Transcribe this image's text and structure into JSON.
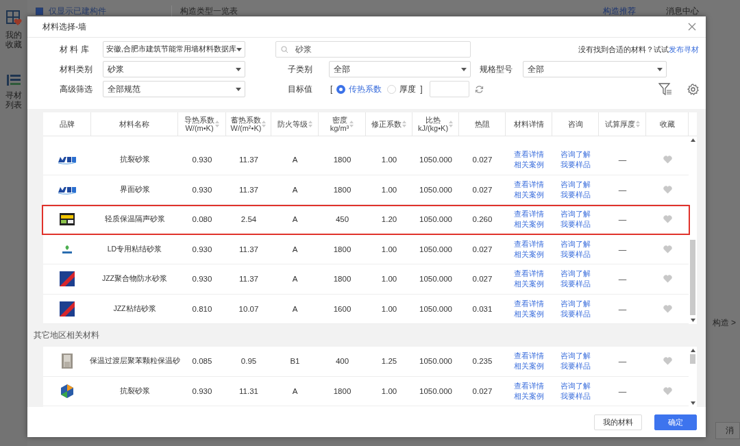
{
  "background": {
    "sidebar": [
      {
        "label": "我的收藏",
        "kind": "favorites"
      },
      {
        "label": "寻材列表",
        "kind": "list"
      }
    ],
    "filter_checkbox": {
      "label": "仅显示已建构件",
      "checked": true
    },
    "panel_title": "构造类型一览表",
    "tabs": [
      {
        "label": "构造推荐",
        "selected": true
      },
      {
        "label": "消息中心",
        "selected": false
      }
    ],
    "side_link": "构造 >",
    "side_button": "消"
  },
  "dialog": {
    "title": "材料选择-墙",
    "library": {
      "label": "材 料 库",
      "value": "安徽,合肥市建筑节能常用墙材料数据库"
    },
    "search": {
      "value": "砂浆"
    },
    "hint": {
      "text": "没有找到合适的材料？试试",
      "link": "发布寻材"
    },
    "category": {
      "label": "材料类别",
      "value": "砂浆"
    },
    "subcategory": {
      "label": "子类别",
      "value": "全部"
    },
    "spec": {
      "label": "规格型号",
      "value": "全部"
    },
    "advanced": {
      "label": "高级筛选",
      "value": "全部规范"
    },
    "target": {
      "label": "目标值",
      "open": "[",
      "close": "]",
      "options": [
        {
          "label": "传热系数",
          "selected": true
        },
        {
          "label": "厚度",
          "selected": false
        }
      ]
    },
    "table": {
      "columns": [
        {
          "label": "品牌",
          "sortable": false
        },
        {
          "label": "材料名称",
          "sortable": false
        },
        {
          "label": "导热系数",
          "unit": "W/(m•K)",
          "sortable": true
        },
        {
          "label": "蓄热系数",
          "unit": "W/(m²•K)",
          "sortable": true
        },
        {
          "label": "防火等级",
          "sortable": true
        },
        {
          "label": "密度",
          "unit": "kg/m³",
          "sortable": true
        },
        {
          "label": "修正系数",
          "sortable": true
        },
        {
          "label": "比热",
          "unit": "kJ/(kg•K)",
          "sortable": true
        },
        {
          "label": "热阻",
          "sortable": false
        },
        {
          "label": "材料详情",
          "sortable": false
        },
        {
          "label": "咨询",
          "sortable": false
        },
        {
          "label": "试算厚度",
          "sortable": true
        },
        {
          "label": "收藏",
          "sortable": false
        }
      ],
      "rows": [
        {
          "kind": "met",
          "name": "抗裂砂浆",
          "values": [
            "0.930",
            "11.37",
            "A",
            "1800",
            "1.00",
            "1050.000",
            "0.027"
          ],
          "details": [
            "查看详情",
            "相关案例"
          ],
          "consult": [
            "咨询了解",
            "我要样品"
          ],
          "thickness": "—",
          "favorite": false,
          "selected": false
        },
        {
          "kind": "met",
          "name": "界面砂浆",
          "values": [
            "0.930",
            "11.37",
            "A",
            "1800",
            "1.00",
            "1050.000",
            "0.027"
          ],
          "details": [
            "查看详情",
            "相关案例"
          ],
          "consult": [
            "咨询了解",
            "我要样品"
          ],
          "thickness": "—",
          "favorite": false,
          "selected": false
        },
        {
          "kind": "tile",
          "name": "轻质保温隔声砂浆",
          "values": [
            "0.080",
            "2.54",
            "A",
            "450",
            "1.20",
            "1050.000",
            "0.260"
          ],
          "details": [
            "查看详情",
            "相关案例"
          ],
          "consult": [
            "咨询了解",
            "我要样品"
          ],
          "thickness": "—",
          "favorite": false,
          "selected": true
        },
        {
          "kind": "leaf",
          "name": "LD专用粘结砂浆",
          "values": [
            "0.930",
            "11.37",
            "A",
            "1800",
            "1.00",
            "1050.000",
            "0.027"
          ],
          "details": [
            "查看详情",
            "相关案例"
          ],
          "consult": [
            "咨询了解",
            "我要样品"
          ],
          "thickness": "—",
          "favorite": false,
          "selected": false
        },
        {
          "kind": "diagonal",
          "name": "JZZ聚合物防水砂浆",
          "values": [
            "0.930",
            "11.37",
            "A",
            "1800",
            "1.00",
            "1050.000",
            "0.027"
          ],
          "details": [
            "查看详情",
            "相关案例"
          ],
          "consult": [
            "咨询了解",
            "我要样品"
          ],
          "thickness": "—",
          "favorite": false,
          "selected": false
        },
        {
          "kind": "diagonal",
          "name": "JZZ粘结砂浆",
          "values": [
            "0.810",
            "10.07",
            "A",
            "1600",
            "1.00",
            "1050.000",
            "0.031"
          ],
          "details": [
            "查看详情",
            "相关案例"
          ],
          "consult": [
            "咨询了解",
            "我要样品"
          ],
          "thickness": "—",
          "favorite": false,
          "selected": false
        }
      ]
    },
    "other_title": "其它地区相关材料",
    "other_rows": [
      {
        "name": "保温过渡层聚苯颗粒保温砂",
        "values": [
          "0.085",
          "0.95",
          "B1",
          "400",
          "1.25",
          "1050.000",
          "0.235"
        ],
        "details": [
          "查看详情",
          "相关案例"
        ],
        "consult": [
          "咨询了解",
          "我要样品"
        ],
        "thickness": "—",
        "favorite": false,
        "selected": false
      },
      {
        "kind": "cube",
        "name": "抗裂砂浆",
        "values": [
          "0.930",
          "11.31",
          "A",
          "1800",
          "1.00",
          "1050.000",
          "0.027"
        ],
        "details": [
          "查看详情",
          "相关案例"
        ],
        "consult": [
          "咨询了解",
          "我要样品"
        ],
        "thickness": "—",
        "favorite": false,
        "selected": false
      }
    ],
    "buttons": [
      {
        "label": "我的材料",
        "kind": "secondary"
      },
      {
        "label": "确定",
        "kind": "primary"
      }
    ]
  }
}
